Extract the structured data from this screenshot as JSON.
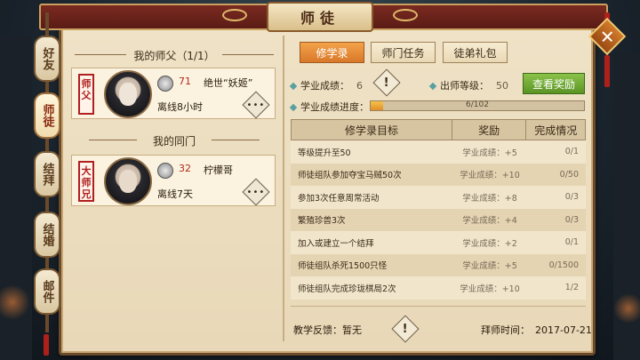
{
  "window": {
    "title": "师徒"
  },
  "side_tabs": [
    {
      "label": "好友"
    },
    {
      "label": "师徒"
    },
    {
      "label": "结拜"
    },
    {
      "label": "结婚"
    },
    {
      "label": "邮件"
    }
  ],
  "master": {
    "heading": "我的师父（1/1）",
    "seal": "师父",
    "level": "71",
    "name": "绝世“妖姬”",
    "status": "离线8小时"
  },
  "peers": {
    "heading": "我的同门",
    "seal": "大师兄",
    "level": "32",
    "name": "柠檬哥",
    "status": "离线7天"
  },
  "tabs": [
    {
      "label": "修学录",
      "active": true
    },
    {
      "label": "师门任务",
      "active": false
    },
    {
      "label": "徒弟礼包",
      "active": false
    }
  ],
  "stats": {
    "score_label": "学业成绩：",
    "score_value": "6",
    "grad_label": "出师等级：",
    "grad_value": "50",
    "reward_button": "查看奖励",
    "progress_label": "学业成绩进度：",
    "progress_text": "6/102",
    "progress_current": 6,
    "progress_max": 102
  },
  "table": {
    "headers": [
      "修学录目标",
      "奖励",
      "完成情况"
    ],
    "rows": [
      {
        "goal": "等级提升至50",
        "reward": "学业成绩：+5",
        "done": "0/1"
      },
      {
        "goal": "师徒组队参加夺宝马贼50次",
        "reward": "学业成绩：+10",
        "done": "0/50"
      },
      {
        "goal": "参加3次任意周常活动",
        "reward": "学业成绩：+8",
        "done": "0/3"
      },
      {
        "goal": "繁殖珍兽3次",
        "reward": "学业成绩：+4",
        "done": "0/3"
      },
      {
        "goal": "加入或建立一个结拜",
        "reward": "学业成绩：+2",
        "done": "0/1"
      },
      {
        "goal": "师徒组队杀死1500只怪",
        "reward": "学业成绩：+5",
        "done": "0/1500"
      },
      {
        "goal": "师徒组队完成珍珑棋局2次",
        "reward": "学业成绩：+10",
        "done": "1/2"
      }
    ]
  },
  "footer": {
    "feedback_label": "教学反馈：",
    "feedback_value": "暂无",
    "date_label": "拜师时间：",
    "date_value": "2017-07-21"
  },
  "icons": {
    "close": "close-icon",
    "warning": "exclamation-icon",
    "more": "ellipsis-icon",
    "level": "level-badge-icon"
  },
  "colors": {
    "panel": "#efe2c6",
    "title_bar": "#7a2a20",
    "tab_active": "#e08a36",
    "reward_button": "#6fa83a",
    "level_number": "#b02a1a",
    "seal": "#b02020"
  }
}
